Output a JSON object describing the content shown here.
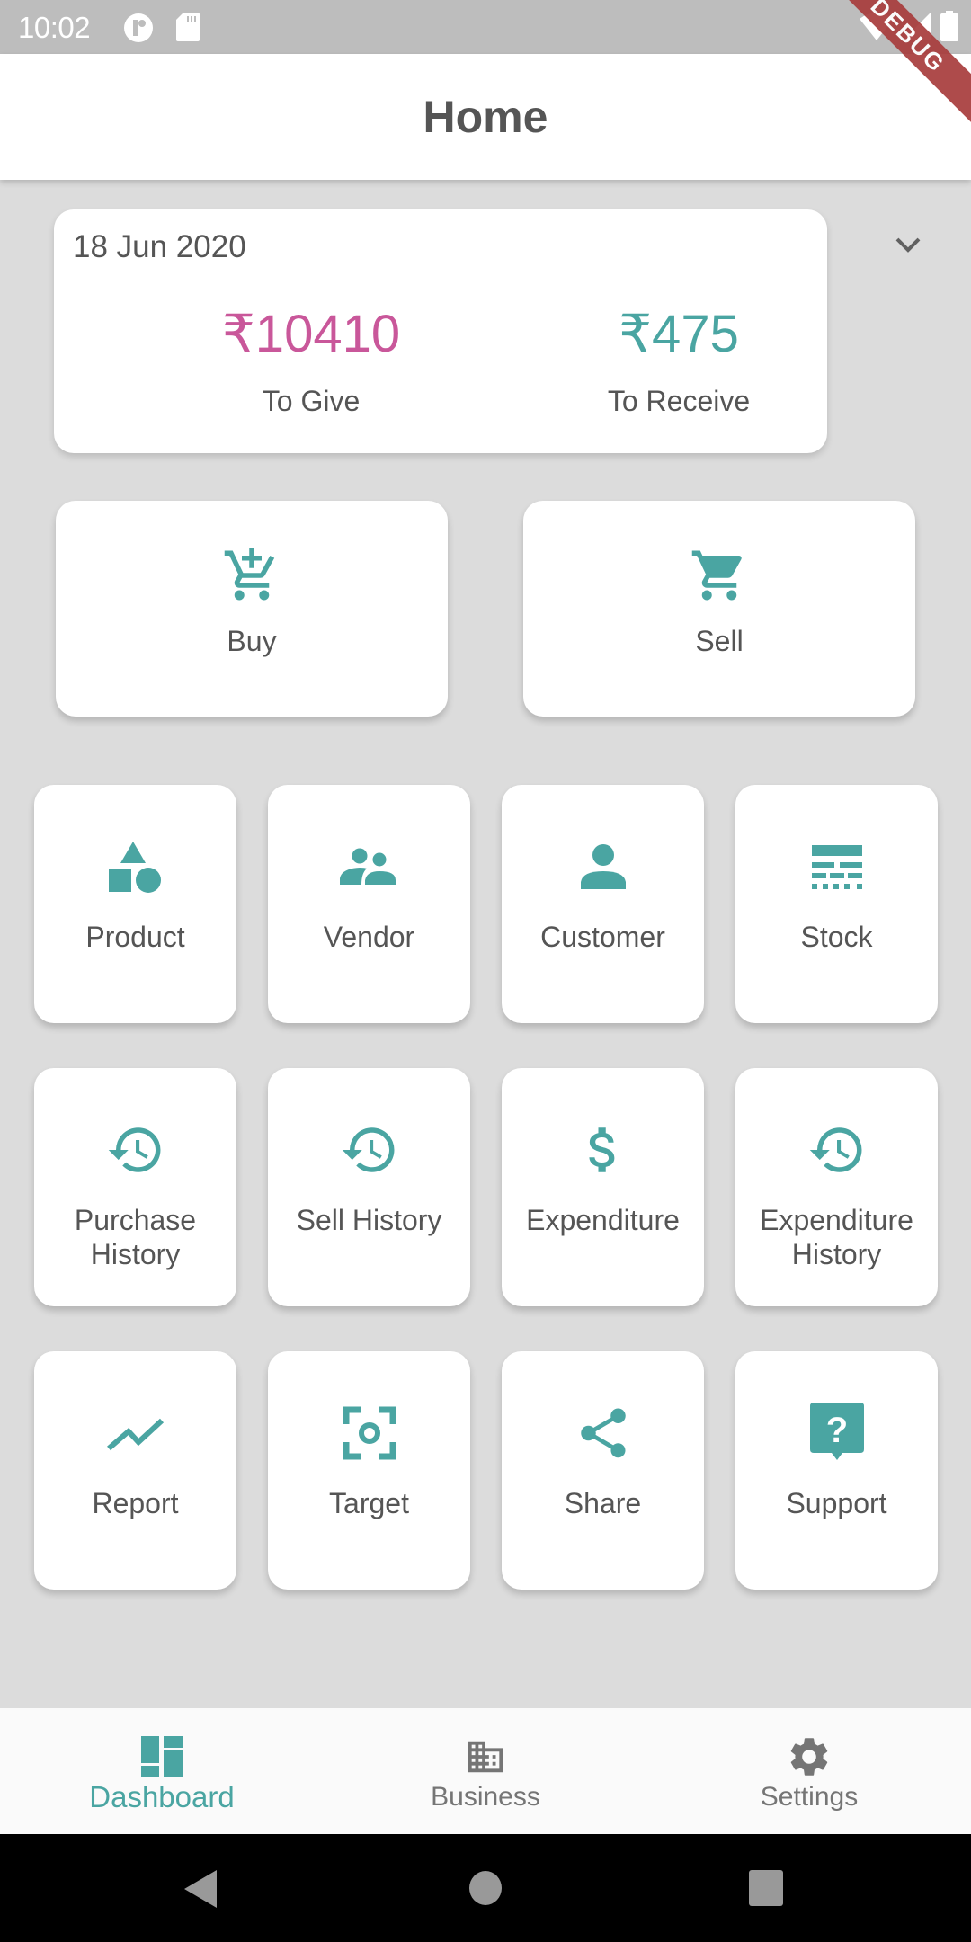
{
  "status_bar": {
    "time": "10:02",
    "left_icons": [
      "notification-app-icon",
      "sd-card-icon"
    ],
    "right_icons": [
      "wifi-icon",
      "cell-signal-icon",
      "battery-icon"
    ]
  },
  "debug_banner": {
    "label": "DEBUG",
    "color": "#a83c3c"
  },
  "app_bar": {
    "title": "Home"
  },
  "summary": {
    "date": "18 Jun 2020",
    "to_give": {
      "amount": "₹10410",
      "label": "To Give",
      "color": "#c9579a"
    },
    "to_receive": {
      "amount": "₹475",
      "label": "To Receive",
      "color": "#4aa5a2"
    },
    "expand_icon": "chevron-down-icon"
  },
  "primary_actions": [
    {
      "label": "Buy",
      "icon": "add-shopping-cart-icon"
    },
    {
      "label": "Sell",
      "icon": "shopping-cart-icon"
    }
  ],
  "grid": [
    {
      "label": "Product",
      "icon": "category-shapes-icon"
    },
    {
      "label": "Vendor",
      "icon": "people-icon"
    },
    {
      "label": "Customer",
      "icon": "person-icon"
    },
    {
      "label": "Stock",
      "icon": "stock-layers-icon"
    },
    {
      "label": "Purchase History",
      "icon": "history-icon"
    },
    {
      "label": "Sell History",
      "icon": "history-icon"
    },
    {
      "label": "Expenditure",
      "icon": "dollar-icon"
    },
    {
      "label": "Expenditure History",
      "icon": "history-icon"
    },
    {
      "label": "Report",
      "icon": "trending-line-icon"
    },
    {
      "label": "Target",
      "icon": "center-focus-icon"
    },
    {
      "label": "Share",
      "icon": "share-icon"
    },
    {
      "label": "Support",
      "icon": "help-bubble-icon"
    }
  ],
  "bottom_nav": {
    "items": [
      {
        "label": "Dashboard",
        "icon": "dashboard-icon",
        "active": true
      },
      {
        "label": "Business",
        "icon": "business-building-icon",
        "active": false
      },
      {
        "label": "Settings",
        "icon": "gear-icon",
        "active": false
      }
    ]
  },
  "theme": {
    "accent": "#4aa5a2",
    "give_color": "#c9579a",
    "background": "#dcdcdc",
    "text": "#555555"
  }
}
